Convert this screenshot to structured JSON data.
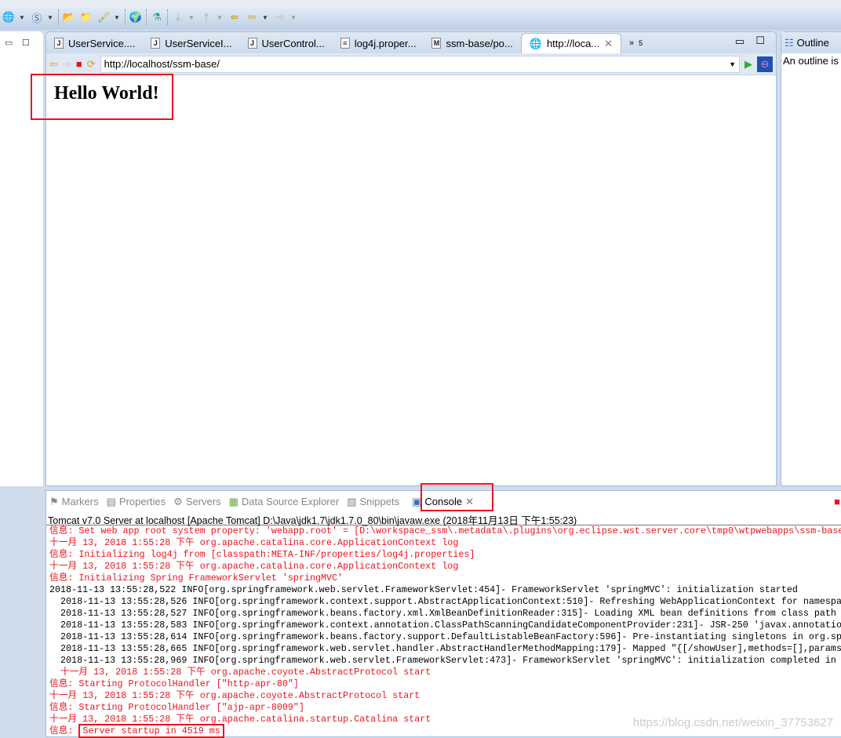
{
  "editor": {
    "tabs": [
      {
        "label": "UserService....",
        "icon": "java-file-icon"
      },
      {
        "label": "UserServiceI...",
        "icon": "java-file-icon"
      },
      {
        "label": "UserControl...",
        "icon": "java-file-icon"
      },
      {
        "label": "log4j.proper...",
        "icon": "properties-file-icon"
      },
      {
        "label": "ssm-base/po...",
        "icon": "maven-pom-icon"
      },
      {
        "label": "http://loca...",
        "icon": "globe-icon",
        "active": true
      }
    ],
    "overflow_count": "5",
    "url": "http://localhost/ssm-base/",
    "page_heading": "Hello World!"
  },
  "outline": {
    "title": "Outline",
    "message": "An outline is"
  },
  "console": {
    "tabs": [
      "Markers",
      "Properties",
      "Servers",
      "Data Source Explorer",
      "Snippets",
      "Console"
    ],
    "header": "Tomcat v7.0 Server at localhost [Apache Tomcat] D:\\Java\\jdk1.7\\jdk1.7.0_80\\bin\\javaw.exe (2018年11月13日 下午1:55:23)",
    "lines": [
      {
        "t": "信息: Set web app root system property: 'webapp.root' = [D:\\workspace_ssm\\.metadata\\.plugins\\org.eclipse.wst.server.core\\tmp0\\wtpwebapps\\ssm-base\\",
        "err": true
      },
      {
        "t": "十一月 13, 2018 1:55:28 下午 org.apache.catalina.core.ApplicationContext log",
        "err": true
      },
      {
        "t": "信息: Initializing log4j from [classpath:META-INF/properties/log4j.properties]",
        "err": true
      },
      {
        "t": "十一月 13, 2018 1:55:28 下午 org.apache.catalina.core.ApplicationContext log",
        "err": true
      },
      {
        "t": "信息: Initializing Spring FrameworkServlet 'springMVC'",
        "err": true
      },
      {
        "t": "2018-11-13 13:55:28,522 INFO[org.springframework.web.servlet.FrameworkServlet:454]- FrameworkServlet 'springMVC': initialization started",
        "err": false
      },
      {
        "t": "  2018-11-13 13:55:28,526 INFO[org.springframework.context.support.AbstractApplicationContext:510]- Refreshing WebApplicationContext for namespa",
        "err": false
      },
      {
        "t": "  2018-11-13 13:55:28,527 INFO[org.springframework.beans.factory.xml.XmlBeanDefinitionReader:315]- Loading XML bean definitions from class path",
        "err": false
      },
      {
        "t": "  2018-11-13 13:55:28,583 INFO[org.springframework.context.annotation.ClassPathScanningCandidateComponentProvider:231]- JSR-250 'javax.annotatio",
        "err": false
      },
      {
        "t": "  2018-11-13 13:55:28,614 INFO[org.springframework.beans.factory.support.DefaultListableBeanFactory:596]- Pre-instantiating singletons in org.sp",
        "err": false
      },
      {
        "t": "  2018-11-13 13:55:28,665 INFO[org.springframework.web.servlet.handler.AbstractHandlerMethodMapping:179]- Mapped \"{[/showUser],methods=[],params",
        "err": false
      },
      {
        "t": "  2018-11-13 13:55:28,969 INFO[org.springframework.web.servlet.FrameworkServlet:473]- FrameworkServlet 'springMVC': initialization completed in -",
        "err": false
      },
      {
        "t": "  十一月 13, 2018 1:55:28 下午 org.apache.coyote.AbstractProtocol start",
        "err": true
      },
      {
        "t": "信息: Starting ProtocolHandler [\"http-apr-80\"]",
        "err": true
      },
      {
        "t": "十一月 13, 2018 1:55:28 下午 org.apache.coyote.AbstractProtocol start",
        "err": true
      },
      {
        "t": "信息: Starting ProtocolHandler [\"ajp-apr-8009\"]",
        "err": true
      },
      {
        "t": "十一月 13, 2018 1:55:28 下午 org.apache.catalina.startup.Catalina start",
        "err": true
      }
    ],
    "last_prefix": "信息: ",
    "last_line": "Server startup in 4519 ms"
  },
  "watermark": "https://blog.csdn.net/weixin_37753627",
  "colors": {
    "error": "#e8141e",
    "highlight_box": "#e8141e"
  }
}
